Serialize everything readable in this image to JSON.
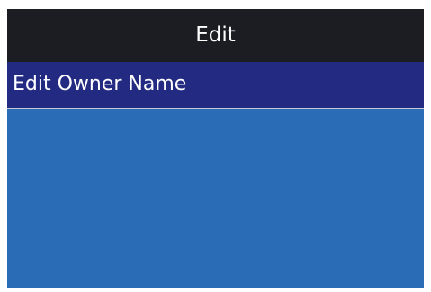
{
  "header": {
    "title": "Edit"
  },
  "menu": {
    "items": [
      {
        "label": "Edit Owner Name",
        "selected": true
      }
    ]
  },
  "colors": {
    "title_bar": "#1b1d22",
    "selected_item": "#232a82",
    "background": "#2a6db6",
    "text": "#ffffff"
  }
}
